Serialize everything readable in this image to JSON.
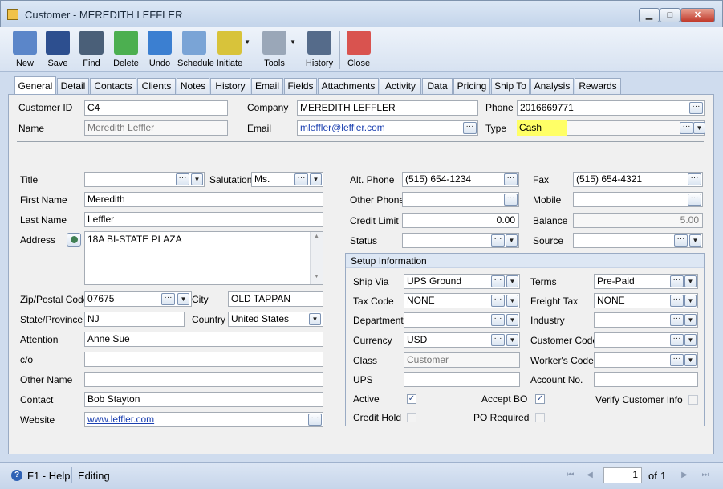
{
  "window": {
    "title": "Customer - MEREDITH LEFFLER",
    "min": "▁",
    "max": "□",
    "close": "✕"
  },
  "toolbar": [
    {
      "label": "New",
      "icon": "new-document-icon",
      "color": "#5b86c9"
    },
    {
      "label": "Save",
      "icon": "floppy-disk-icon",
      "color": "#2d4f8f"
    },
    {
      "label": "Find",
      "icon": "binoculars-icon",
      "color": "#4a5f78"
    },
    {
      "label": "Delete",
      "icon": "recycle-bin-icon",
      "color": "#4caf50"
    },
    {
      "label": "Undo",
      "icon": "undo-arrow-icon",
      "color": "#3b7fd1"
    },
    {
      "label": "Schedule",
      "icon": "calendar-clock-icon",
      "color": "#7aa4d6"
    },
    {
      "label": "Initiate",
      "icon": "traffic-light-icon",
      "color": "#d8c33a"
    },
    {
      "label": "Tools",
      "icon": "tools-icon",
      "color": "#9aa7b8"
    },
    {
      "label": "History",
      "icon": "person-history-icon",
      "color": "#556b8a"
    },
    {
      "label": "Close",
      "icon": "close-window-icon",
      "color": "#d9534f"
    }
  ],
  "tabs": [
    "General",
    "Detail",
    "Contacts",
    "Clients",
    "Notes",
    "History",
    "Email",
    "Fields",
    "Attachments",
    "Activity",
    "Data",
    "Pricing",
    "Ship To",
    "Analysis",
    "Rewards"
  ],
  "header": {
    "customer_id_label": "Customer ID",
    "customer_id": "C4",
    "company_label": "Company",
    "company": "MEREDITH LEFFLER",
    "phone_label": "Phone",
    "phone": "2016669771",
    "name_label": "Name",
    "name": "Meredith Leffler",
    "email_label": "Email",
    "email": "mleffler@leffler.com",
    "type_label": "Type",
    "type": "Cash",
    "highlight_color": "#ffff66"
  },
  "left": {
    "title_label": "Title",
    "title": "",
    "salutation_label": "Salutation",
    "salutation": "Ms.",
    "first_name_label": "First Name",
    "first_name": "Meredith",
    "last_name_label": "Last Name",
    "last_name": "Leffler",
    "address_label": "Address",
    "address": "18A BI-STATE PLAZA",
    "zip_label": "Zip/Postal Code",
    "zip": "07675",
    "city_label": "City",
    "city": "OLD TAPPAN",
    "state_label": "State/Province",
    "state": "NJ",
    "country_label": "Country",
    "country": "United States",
    "attention_label": "Attention",
    "attention": "Anne Sue",
    "co_label": "c/o",
    "co": "",
    "other_name_label": "Other Name",
    "other_name": "",
    "contact_label": "Contact",
    "contact": "Bob Stayton",
    "website_label": "Website",
    "website": "www.leffler.com"
  },
  "right": {
    "alt_phone_label": "Alt. Phone",
    "alt_phone": "(515) 654-1234",
    "fax_label": "Fax",
    "fax": "(515) 654-4321",
    "other_phone_label": "Other Phone",
    "other_phone": "",
    "mobile_label": "Mobile",
    "mobile": "",
    "credit_limit_label": "Credit Limit",
    "credit_limit": "0.00",
    "balance_label": "Balance",
    "balance": "5.00",
    "status_label": "Status",
    "status": "",
    "source_label": "Source",
    "source": ""
  },
  "setup": {
    "heading": "Setup Information",
    "ship_via_label": "Ship Via",
    "ship_via": "UPS Ground",
    "terms_label": "Terms",
    "terms": "Pre-Paid",
    "tax_code_label": "Tax Code",
    "tax_code": "NONE",
    "freight_tax_label": "Freight Tax",
    "freight_tax": "NONE",
    "department_label": "Department",
    "department": "",
    "industry_label": "Industry",
    "industry": "",
    "currency_label": "Currency",
    "currency": "USD",
    "customer_code_label": "Customer Code",
    "customer_code": "",
    "class_label": "Class",
    "class": "Customer",
    "workers_code_label": "Worker's Code",
    "workers_code": "",
    "ups_label": "UPS",
    "ups": "",
    "account_no_label": "Account No.",
    "account_no": "",
    "active_label": "Active",
    "active": true,
    "accept_bo_label": "Accept BO",
    "accept_bo": true,
    "verify_label": "Verify Customer Info",
    "verify": false,
    "credit_hold_label": "Credit Hold",
    "credit_hold": false,
    "po_required_label": "PO Required",
    "po_required": false
  },
  "status": {
    "help": "F1 - Help",
    "mode": "Editing",
    "page": "1",
    "of_label": "of",
    "total": "1"
  }
}
